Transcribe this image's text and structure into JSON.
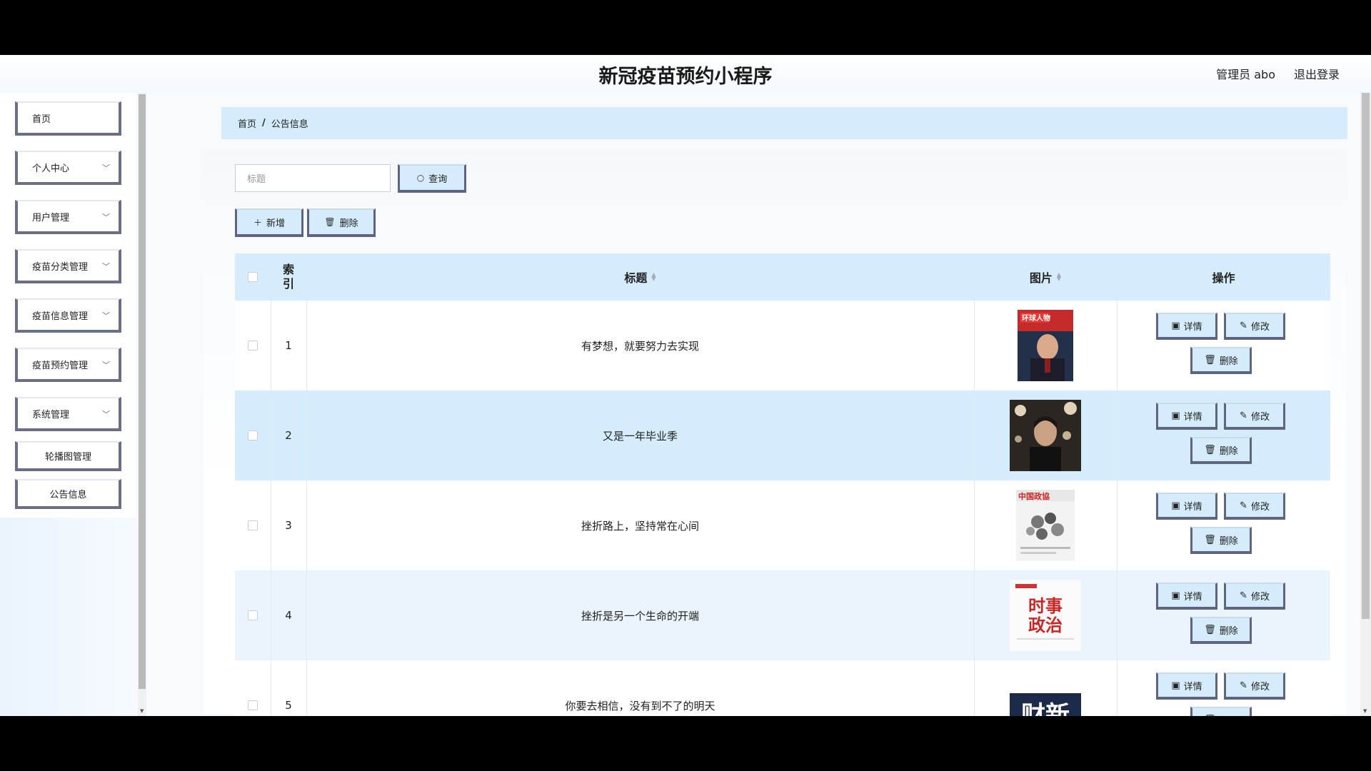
{
  "app": {
    "title": "新冠疫苗预约小程序",
    "user_label": "管理员 abo",
    "logout": "退出登录"
  },
  "sidebar": {
    "items": [
      {
        "label": "首页",
        "has_children": false
      },
      {
        "label": "个人中心",
        "has_children": true
      },
      {
        "label": "用户管理",
        "has_children": true
      },
      {
        "label": "疫苗分类管理",
        "has_children": true
      },
      {
        "label": "疫苗信息管理",
        "has_children": true
      },
      {
        "label": "疫苗预约管理",
        "has_children": true
      },
      {
        "label": "系统管理",
        "has_children": true
      }
    ],
    "sub_items": [
      {
        "label": "轮播图管理"
      },
      {
        "label": "公告信息"
      }
    ]
  },
  "breadcrumb": {
    "home": "首页",
    "sep": "/",
    "current": "公告信息"
  },
  "search": {
    "placeholder": "标题",
    "button": "查询"
  },
  "toolbar": {
    "add": "新增",
    "delete": "删除"
  },
  "table": {
    "headers": {
      "index": "索引",
      "title": "标题",
      "image": "图片",
      "actions": "操作"
    },
    "rows": [
      {
        "index": "1",
        "title": "有梦想，就要努力去实现",
        "image": "magazine-cover-1"
      },
      {
        "index": "2",
        "title": "又是一年毕业季",
        "image": "portrait-photo"
      },
      {
        "index": "3",
        "title": "挫折路上，坚持常在心间",
        "image": "magazine-cover-3"
      },
      {
        "index": "4",
        "title": "挫折是另一个生命的开端",
        "image": "magazine-cover-4"
      },
      {
        "index": "5",
        "title": "你要去相信，没有到不了的明天",
        "image": "magazine-cover-5"
      }
    ],
    "row_actions": {
      "detail": "详情",
      "edit": "修改",
      "delete": "删除"
    }
  },
  "covers": {
    "c1": {
      "title": "环球人物"
    },
    "c3": {
      "title": "中国政協"
    },
    "c4": {
      "title": "时事政治"
    },
    "c5": {
      "title": "财新"
    }
  },
  "colors": {
    "accent": "#d4ecfb",
    "border": "#5f6480"
  }
}
